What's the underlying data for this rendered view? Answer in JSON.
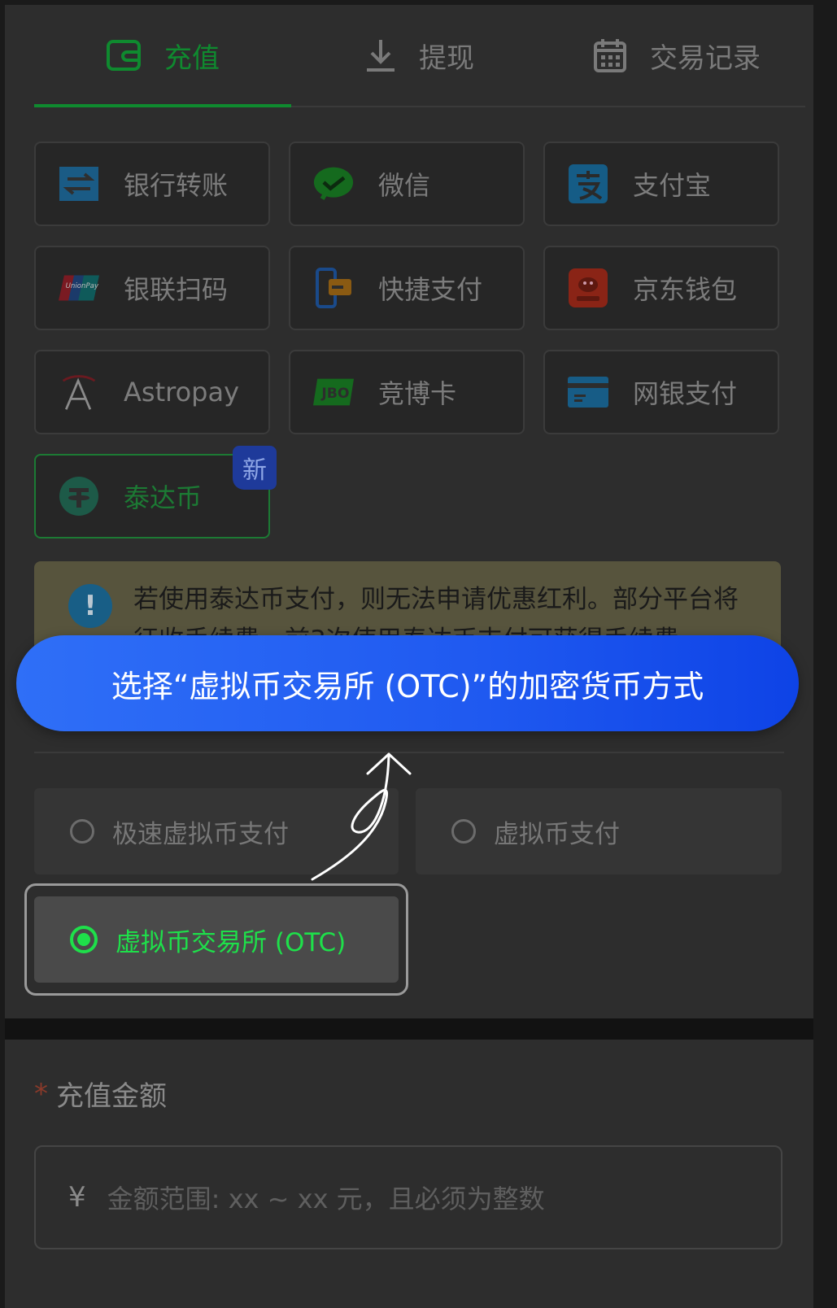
{
  "tabs": [
    {
      "label": "充值",
      "icon": "wallet-icon",
      "active": true
    },
    {
      "label": "提现",
      "icon": "download-icon",
      "active": false
    },
    {
      "label": "交易记录",
      "icon": "calendar-icon",
      "active": false
    }
  ],
  "payment_methods": [
    {
      "label": "银行转账",
      "icon": "bank-transfer-icon"
    },
    {
      "label": "微信",
      "icon": "wechat-icon"
    },
    {
      "label": "支付宝",
      "icon": "alipay-icon"
    },
    {
      "label": "银联扫码",
      "icon": "unionpay-icon"
    },
    {
      "label": "快捷支付",
      "icon": "quick-pay-icon"
    },
    {
      "label": "京东钱包",
      "icon": "jd-wallet-icon"
    },
    {
      "label": "Astropay",
      "icon": "astropay-icon"
    },
    {
      "label": "竞博卡",
      "icon": "jbo-card-icon"
    },
    {
      "label": "网银支付",
      "icon": "online-banking-icon"
    },
    {
      "label": "泰达币",
      "icon": "tether-icon",
      "active": true,
      "badge": "新"
    }
  ],
  "notice": {
    "text": "若使用泰达币支付，则无法申请优惠红利。部分平台将征收手续费，前3次使用泰达币支付可获得手续费"
  },
  "callout": {
    "text": "选择“虚拟币交易所 (OTC)”的加密货币方式"
  },
  "crypto_methods": [
    {
      "label": "极速虚拟币支付",
      "selected": false
    },
    {
      "label": "虚拟币支付",
      "selected": false
    },
    {
      "label": "虚拟币交易所 (OTC)",
      "selected": true
    }
  ],
  "amount": {
    "required_mark": "*",
    "label": "充值金额",
    "currency_symbol": "¥",
    "placeholder": "金额范围: xx ~ xx 元，且必须为整数"
  },
  "colors": {
    "accent_green": "#0f8a2f",
    "callout_blue": "#1f59f0",
    "selected_green": "#1ee04a"
  }
}
